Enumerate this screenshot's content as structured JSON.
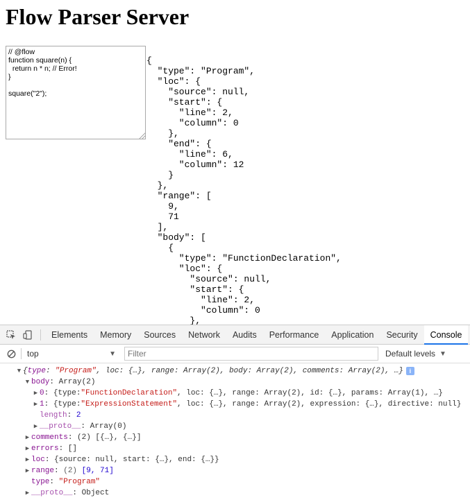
{
  "page": {
    "title": "Flow Parser Server",
    "editor_code": "// @flow\nfunction square(n) {\n  return n * n; // Error!\n}\n\nsquare(\"2\");",
    "ast_output": "{\n  \"type\": \"Program\",\n  \"loc\": {\n    \"source\": null,\n    \"start\": {\n      \"line\": 2,\n      \"column\": 0\n    },\n    \"end\": {\n      \"line\": 6,\n      \"column\": 12\n    }\n  },\n  \"range\": [\n    9,\n    71\n  ],\n  \"body\": [\n    {\n      \"type\": \"FunctionDeclaration\",\n      \"loc\": {\n        \"source\": null,\n        \"start\": {\n          \"line\": 2,\n          \"column\": 0\n        },"
  },
  "devtools": {
    "tabs": [
      "Elements",
      "Memory",
      "Sources",
      "Network",
      "Audits",
      "Performance",
      "Application",
      "Security",
      "Console"
    ],
    "active_tab": "Console",
    "context": "top",
    "filter_placeholder": "Filter",
    "levels_label": "Default levels"
  },
  "console": {
    "root_summary": "{type: \"Program\", loc: {…}, range: Array(2), body: Array(2), comments: Array(2), …}",
    "root_summary_parts": {
      "open": "{",
      "type_key": "type",
      "type_val": "\"Program\"",
      "rest": ", loc: {…}, range: Array(2), body: Array(2), comments: Array(2), …}"
    },
    "info_badge": "i",
    "body_key": "body",
    "body_val": "Array(2)",
    "body_item0": {
      "key": "0",
      "prefix": "{type: ",
      "type_val": "\"FunctionDeclaration\"",
      "rest": ", loc: {…}, range: Array(2), id: {…}, params: Array(1), …}"
    },
    "body_item1": {
      "key": "1",
      "prefix": "{type: ",
      "type_val": "\"ExpressionStatement\"",
      "rest": ", loc: {…}, range: Array(2), expression: {…}, directive: null}"
    },
    "length_key": "length",
    "length_val": "2",
    "proto_key": "__proto__",
    "body_proto_val": "Array(0)",
    "comments_key": "comments",
    "comments_val": "(2) [{…}, {…}]",
    "errors_key": "errors",
    "errors_val": "[]",
    "loc_key": "loc",
    "loc_val": "{source: null, start: {…}, end: {…}}",
    "range_key": "range",
    "range_count": "(2)",
    "range_val": "[9, 71]",
    "type_key": "type",
    "type_val": "\"Program\"",
    "root_proto_val": "Object"
  },
  "colors": {
    "key": "#881391",
    "string": "#c41a16",
    "number": "#1c00cf",
    "active_tab_underline": "#1a73e8"
  },
  "icons": [
    "inspect-element-icon",
    "device-toggle-icon",
    "clear-console-icon",
    "dropdown-arrow-icon",
    "info-icon",
    "expand-triangle-icon",
    "collapse-triangle-icon"
  ]
}
